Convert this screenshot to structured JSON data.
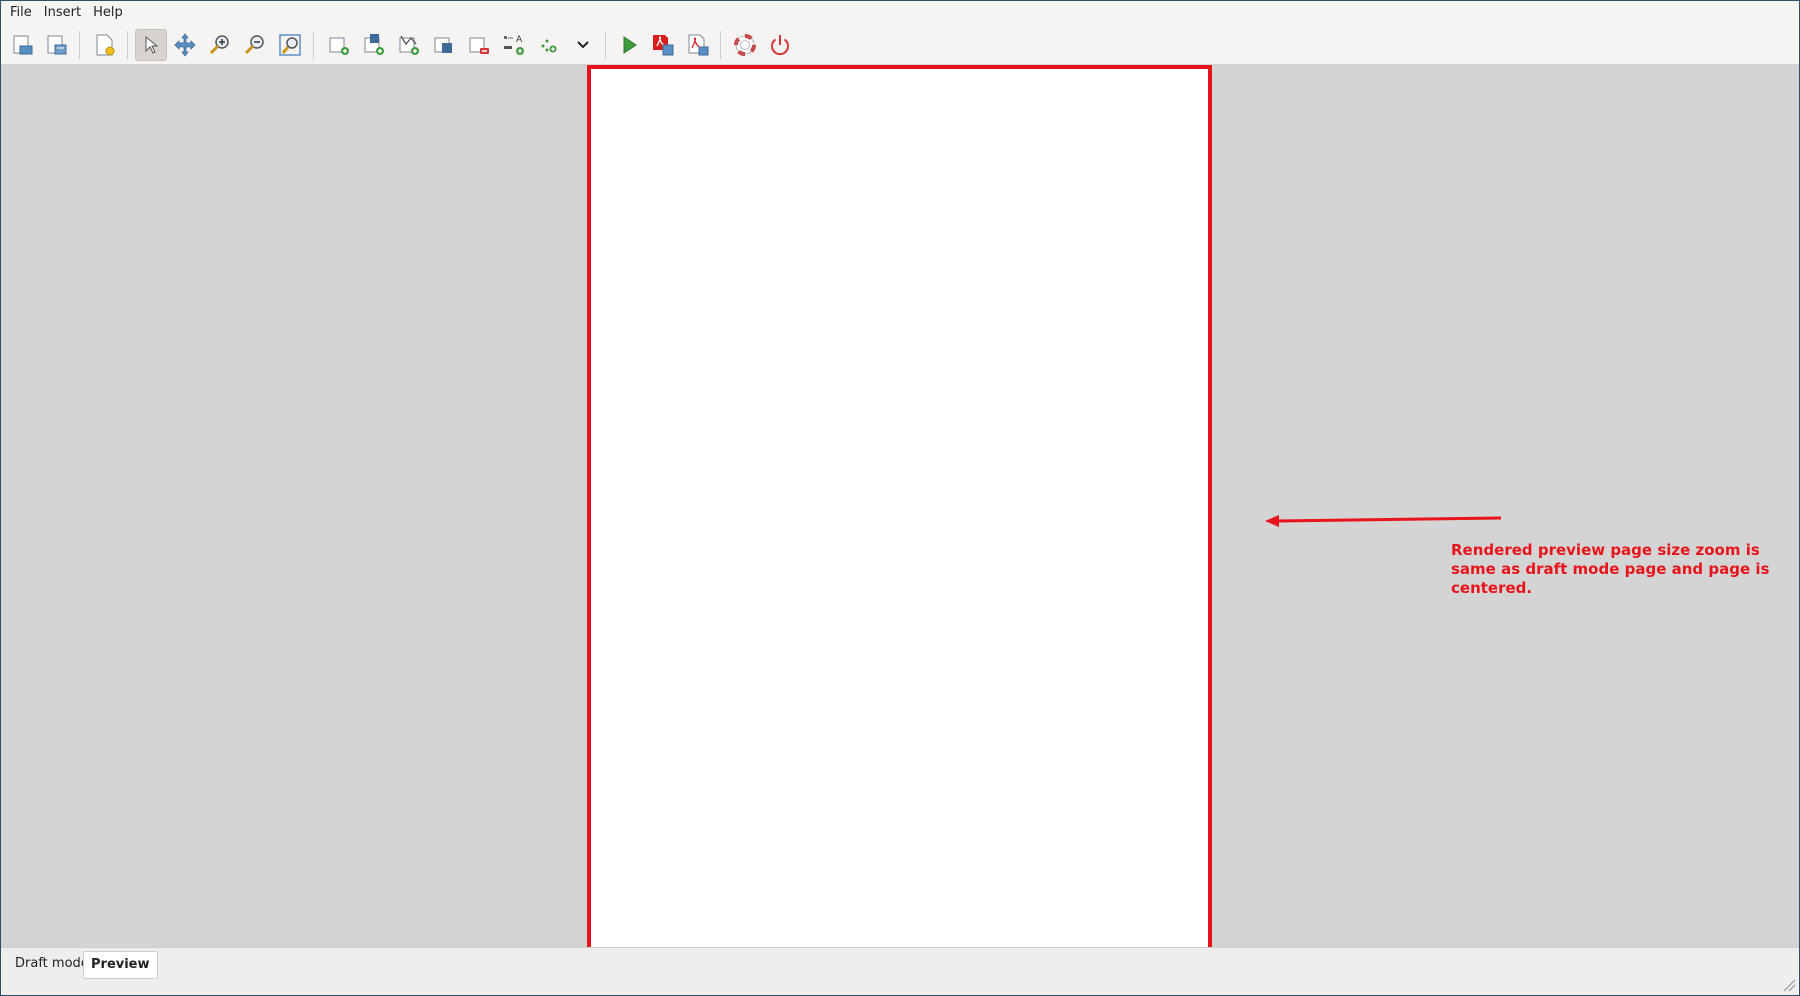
{
  "menubar": {
    "items": [
      "File",
      "Insert",
      "Help"
    ]
  },
  "toolbar": {
    "icons": [
      "open-template-icon",
      "save-template-icon",
      "new-page-icon",
      "select-pointer-icon",
      "pan-icon",
      "zoom-in-icon",
      "zoom-out-icon",
      "zoom-fit-icon",
      "add-frame-icon",
      "add-image-icon",
      "add-chart-icon",
      "duplicate-frame-icon",
      "remove-frame-icon",
      "add-label-icon",
      "add-point-icon",
      "more-dropdown-icon",
      "run-icon",
      "export-pdf-icon",
      "preview-pdf-icon",
      "help-lifebuoy-icon",
      "quit-power-icon"
    ]
  },
  "annotation": {
    "text": "Rendered preview page size zoom is same as draft mode page and page is centered."
  },
  "tabs": [
    {
      "label": "Draft mode",
      "selected": false
    },
    {
      "label": "Preview",
      "selected": true
    }
  ],
  "colors": {
    "annotation": "#e8141b",
    "canvas": "#d4d4d4",
    "page": "#ffffff"
  }
}
